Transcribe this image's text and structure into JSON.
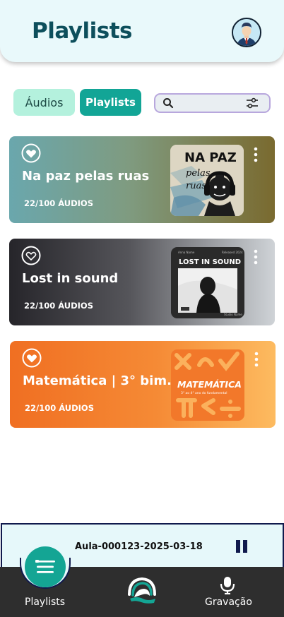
{
  "header": {
    "title": "Playlists",
    "avatar_icon": "user-avatar-icon"
  },
  "tabs": [
    {
      "label": "Áudios",
      "active": false
    },
    {
      "label": "Playlists",
      "active": true
    }
  ],
  "search": {
    "placeholder": "",
    "icon": "search-icon",
    "filter_icon": "filter-sliders-icon"
  },
  "playlists": [
    {
      "name": "Na paz pelas ruas",
      "count": "22/100 ÁUDIOS",
      "cover": {
        "line1": "NA PAZ",
        "line2": "pelas",
        "line3": "ruas"
      }
    },
    {
      "name": "Lost in sound",
      "count": "22/100 ÁUDIOS",
      "cover": {
        "top_left": "Anna Name",
        "top_right": "Released 2024",
        "title": "LOST IN SOUND",
        "bottom_right": "Studio Name"
      }
    },
    {
      "name": "Matemática | 3° bim...",
      "count": "22/100 ÁUDIOS",
      "cover": {
        "title": "MATEMÁTICA",
        "subtitle": "3° ao 4° ano do fundamental"
      }
    }
  ],
  "player": {
    "title": "Aula-000123-2025-03-18",
    "state_icon": "pause-icon"
  },
  "nav": [
    {
      "label": "Playlists",
      "icon": "list-menu-icon"
    },
    {
      "label": "",
      "icon": "app-logo-icon"
    },
    {
      "label": "Gravação",
      "icon": "microphone-icon"
    }
  ],
  "colors": {
    "primary": "#12a596",
    "header_bg": "#e9f9fb",
    "title_color": "#0d4f5c",
    "nav_bg": "#2e2e2e",
    "player_border": "#101a4d"
  }
}
